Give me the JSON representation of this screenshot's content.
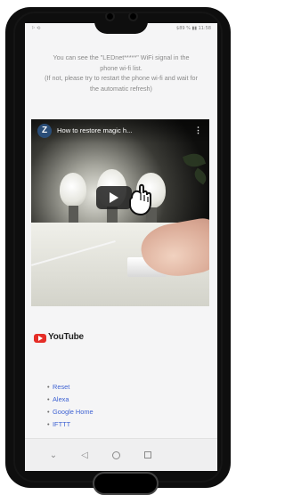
{
  "status_bar": {
    "left": "⚐ ⟲",
    "right": "$89 % ▮▮ 11:58"
  },
  "intro": {
    "line1": "You can see the \"LEDnet*****\" WiFi signal in the",
    "line2": "phone wi-fi list.",
    "line3": "(If not, please try to restart the phone wi-fi and wait for",
    "line4": "the automatic refresh)"
  },
  "video": {
    "channel_initial": "Z",
    "title": "How to restore magic h...",
    "menu_icon": "⋮"
  },
  "youtube": {
    "logo_text": "YouTube"
  },
  "links": [
    {
      "label": "Reset"
    },
    {
      "label": "Alexa"
    },
    {
      "label": "Google Home"
    },
    {
      "label": "IFTTT"
    }
  ],
  "navbar": {
    "chevron_icon": "⌄",
    "back_icon": "◁"
  }
}
